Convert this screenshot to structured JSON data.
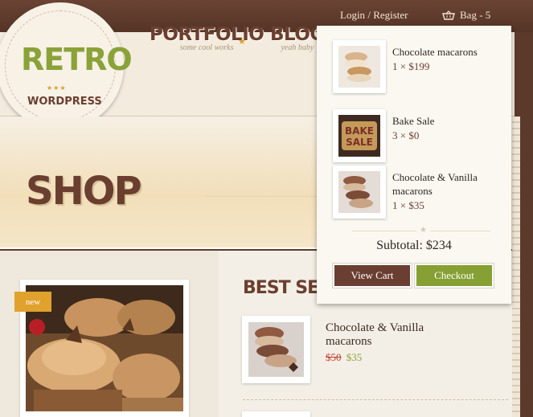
{
  "top": {
    "login": "Login",
    "separator": "/",
    "register": "Register",
    "bag_label": "Bag - 5"
  },
  "logo": {
    "title": "RETRO",
    "stars": "★★★",
    "subtitle": "WORDPRESS"
  },
  "nav": [
    {
      "title": "PORTFOLIO",
      "sub": "some cool works"
    },
    {
      "title": "BLOG",
      "sub": "yeah baby"
    }
  ],
  "page": {
    "title": "SHOP"
  },
  "featured": {
    "badge": "new"
  },
  "best_sellers": {
    "title": "BEST SELLERS",
    "items": [
      {
        "name": "Chocolate & Vanilla macarons",
        "old_price": "$50",
        "price": "$35"
      }
    ]
  },
  "cart": {
    "items": [
      {
        "name": "Chocolate macarons",
        "qty": "1 × $199"
      },
      {
        "name": "Bake Sale",
        "qty": "3 × $0"
      },
      {
        "name": "Chocolate & Vanilla macarons",
        "qty": "1 × $35"
      }
    ],
    "subtotal": "Subtotal: $234",
    "view_cart": "View Cart",
    "checkout": "Checkout"
  }
}
